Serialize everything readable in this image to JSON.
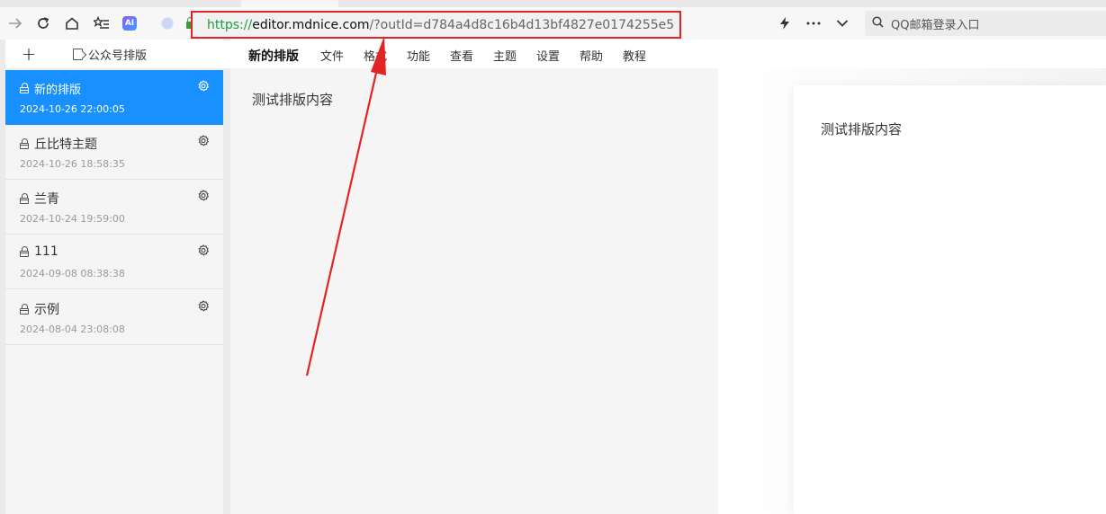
{
  "browser": {
    "url": {
      "scheme": "https",
      "separator": "://",
      "host": "editor.mdnice.com",
      "rest": "/?outId=d784a4d8c16b4d13bf4827e0174255e5"
    },
    "search_placeholder": "QQ邮箱登录入口",
    "icons": [
      "forward-icon",
      "reload-icon",
      "home-icon",
      "favorites-icon",
      "ai-icon",
      "extension-icon",
      "lock-icon",
      "lightning-icon",
      "more-icon",
      "chevron-down-icon",
      "search-icon"
    ]
  },
  "sidebar": {
    "add_label": "+",
    "publish_label": "公众号排版",
    "items": [
      {
        "title": "新的排版",
        "date": "2024-10-26 22:00:05",
        "active": true
      },
      {
        "title": "丘比特主题",
        "date": "2024-10-26 18:58:35",
        "active": false
      },
      {
        "title": "兰青",
        "date": "2024-10-24 19:59:00",
        "active": false
      },
      {
        "title": "111",
        "date": "2024-09-08 08:38:38",
        "active": false
      },
      {
        "title": "示例",
        "date": "2024-08-04 23:08:08",
        "active": false
      }
    ]
  },
  "menu": {
    "brand": "新的排版",
    "items": [
      "文件",
      "格式",
      "功能",
      "查看",
      "主题",
      "设置",
      "帮助",
      "教程"
    ]
  },
  "editor": {
    "content": "测试排版内容"
  },
  "preview": {
    "content": "测试排版内容"
  },
  "colors": {
    "active_item": "#1890ff",
    "annotation": "#e32424",
    "url_scheme": "#1e9b3f"
  }
}
